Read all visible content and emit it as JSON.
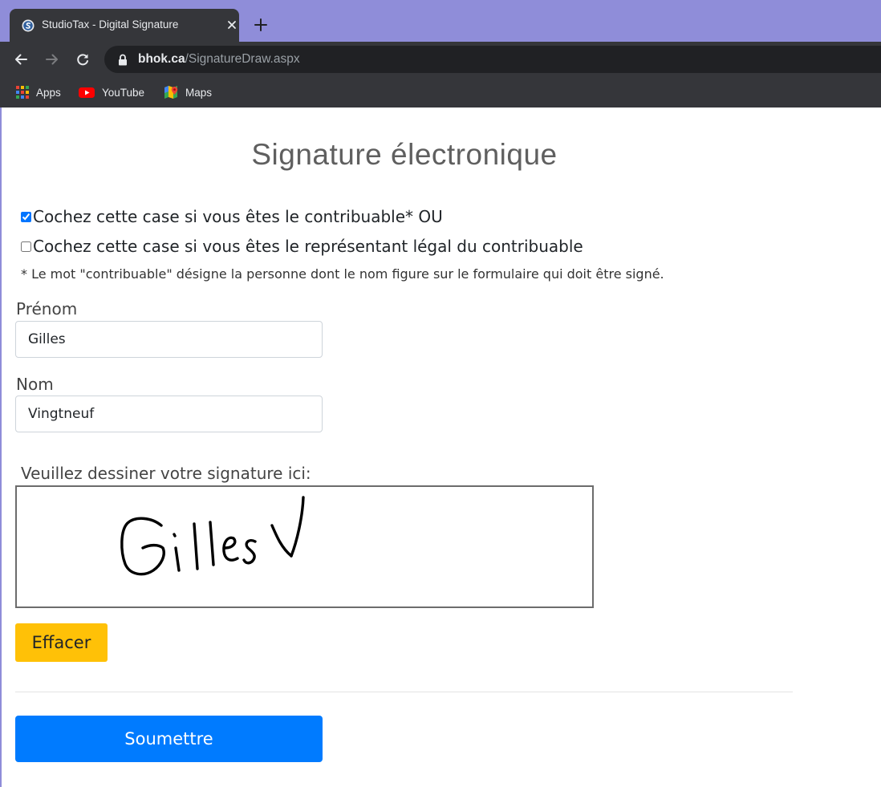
{
  "browser": {
    "tab_title": "StudioTax - Digital Signature",
    "url_host": "bhok.ca",
    "url_path": "/SignatureDraw.aspx",
    "bookmarks": [
      {
        "label": "Apps",
        "icon": "apps-grid-icon"
      },
      {
        "label": "YouTube",
        "icon": "youtube-icon"
      },
      {
        "label": "Maps",
        "icon": "maps-icon"
      }
    ],
    "colors": {
      "tabstrip": "#8f8dd9",
      "toolbar": "#35363a",
      "omnibox": "#202124"
    }
  },
  "page": {
    "heading": "Signature électronique",
    "checkboxes": [
      {
        "label": "Cochez cette case si vous êtes le contribuable* OU",
        "checked": true
      },
      {
        "label": "Cochez cette case si vous êtes le représentant légal du contribuable",
        "checked": false
      }
    ],
    "note": "* Le mot \"contribuable\" désigne la personne dont le nom figure sur le formulaire qui doit être signé.",
    "first_name": {
      "label": "Prénom",
      "value": "Gilles"
    },
    "last_name": {
      "label": "Nom",
      "value": "Vingtneuf"
    },
    "signature": {
      "label": "Veuillez dessiner votre signature ici:"
    },
    "clear_button": "Effacer",
    "submit_button": "Soumettre",
    "colors": {
      "clear_button": "#ffc107",
      "submit_button": "#007bff"
    }
  }
}
